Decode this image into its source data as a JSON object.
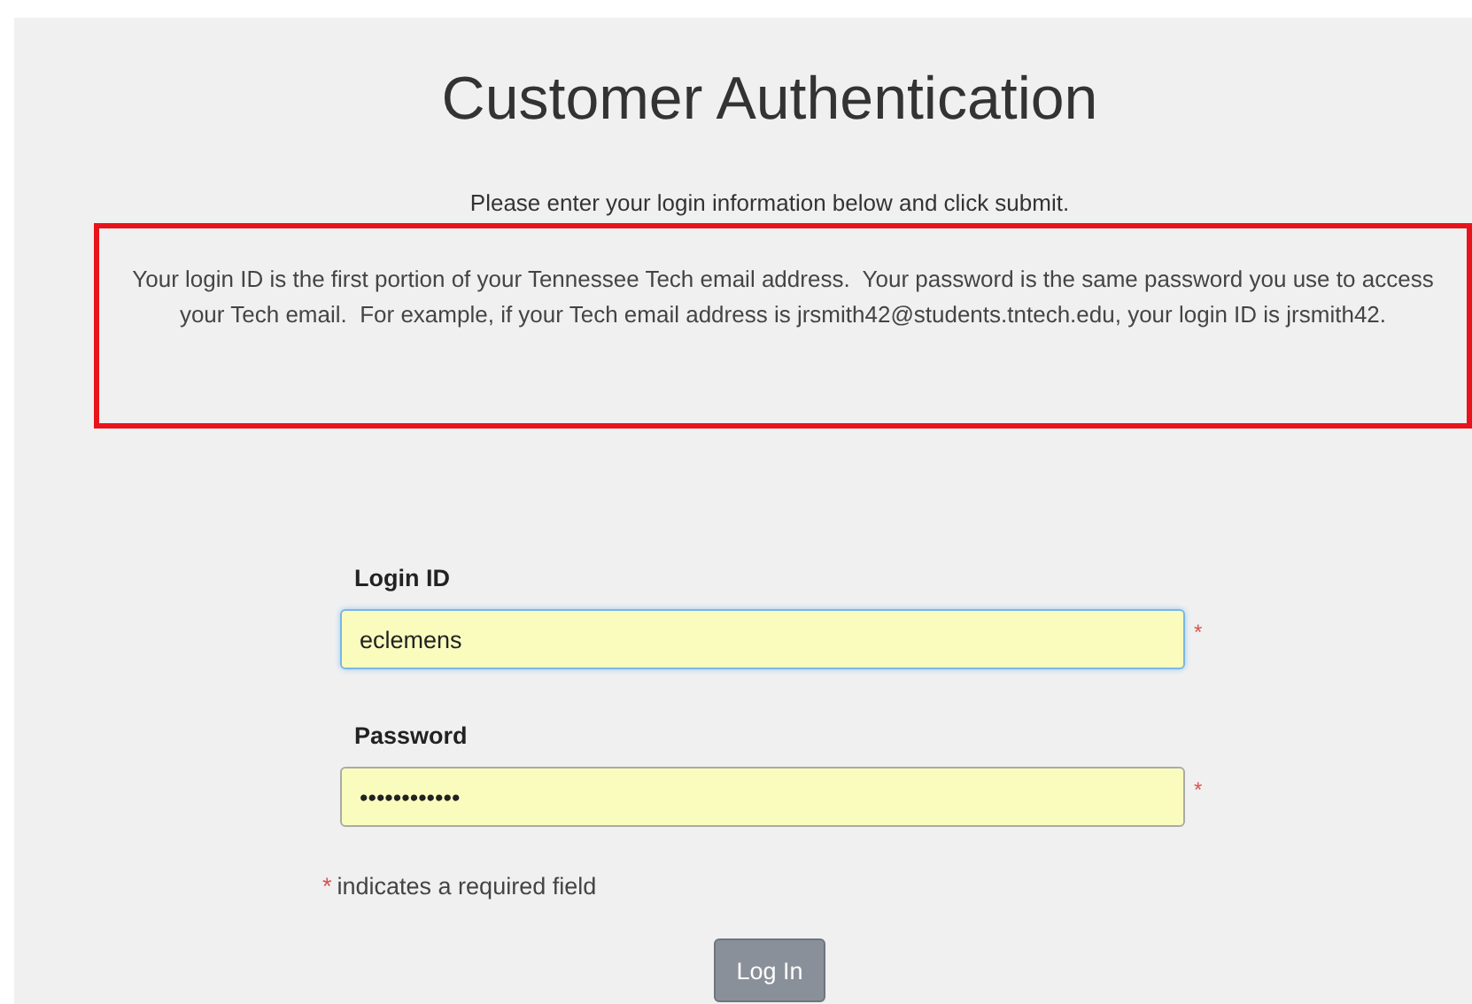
{
  "title": "Customer Authentication",
  "instruction": "Please enter your login information below and click submit.",
  "notice": "Your login ID is the first portion of your Tennessee Tech email address.  Your password is the same password you use to access your Tech email.  For example, if your Tech email address is jrsmith42@students.tntech.edu, your login ID is jrsmith42.",
  "fields": [
    {
      "label": "Login ID",
      "value": "eclemens",
      "focused": true,
      "required": true,
      "required_mark": "*"
    },
    {
      "label": "Password",
      "value": "••••••••••••",
      "focused": false,
      "required": true,
      "required_mark": "*"
    }
  ],
  "required_note": {
    "mark": "*",
    "text": "indicates a required field"
  },
  "submit_button": "Log In"
}
